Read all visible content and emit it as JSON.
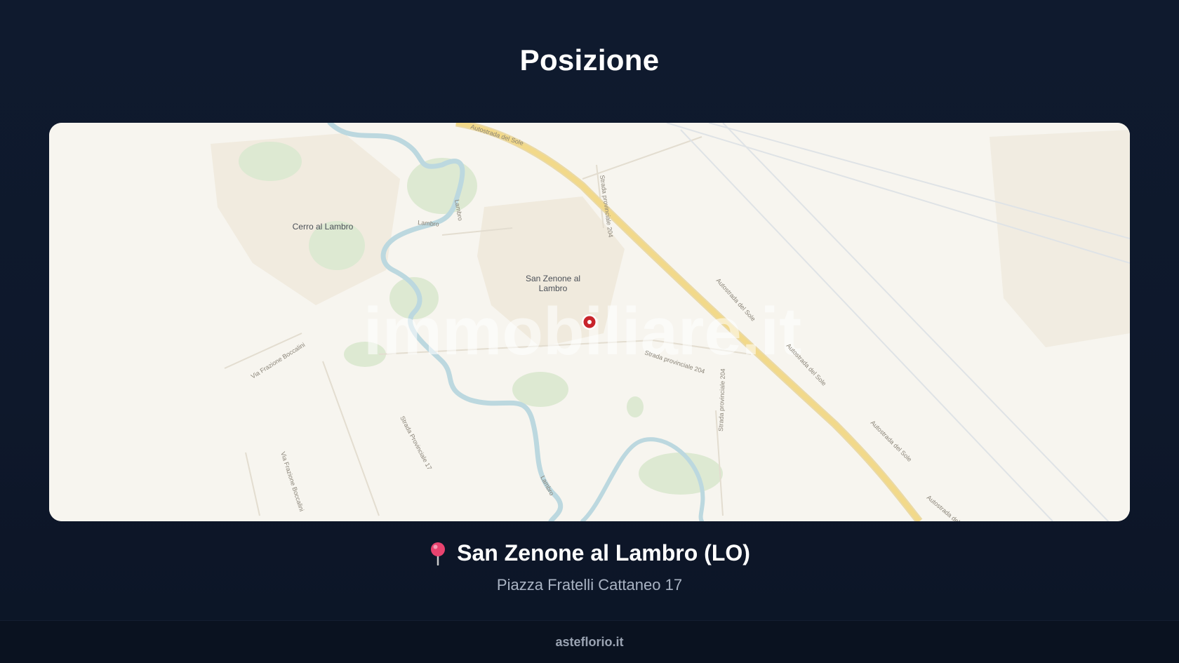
{
  "page": {
    "title": "Posizione"
  },
  "map": {
    "watermark": "immobiliare.it",
    "place_labels": {
      "cerro": "Cerro al Lambro",
      "san_zenone_line1": "San Zenone al",
      "san_zenone_line2": "Lambro"
    },
    "road_labels": {
      "autostrada_1": "Autostrada del Sole",
      "autostrada_2": "Autostrada del Sole",
      "autostrada_3": "Autostrada del Sole",
      "autostrada_4": "Autostrada del Sole",
      "autostrada_5": "Autostrada del Sole",
      "sp_17": "Strada Provinciale 17",
      "sp_204_north": "Strada provinciale 204",
      "sp_204_south": "Strada provinciale 204",
      "via_frazione_1": "Via Frazione Boccalini",
      "via_frazione_2": "Via Frazione Boccalini",
      "sp_small": "Strada provinciale 204",
      "lambro_1": "Lambro",
      "lambro_2": "Lambro",
      "lambro_3": "Lambro"
    },
    "colors": {
      "land": "#f7f5ef",
      "water": "#b9d6dd",
      "green": "#d9e7cf",
      "motorway": "#f2d98a",
      "marker": "#c8242b"
    },
    "marker_icon": "map-marker-icon"
  },
  "location": {
    "pin_icon": "pushpin-icon",
    "name": "San Zenone al Lambro (LO)",
    "address": "Piazza Fratelli Cattaneo 17"
  },
  "footer": {
    "text": "asteflorio.it"
  }
}
